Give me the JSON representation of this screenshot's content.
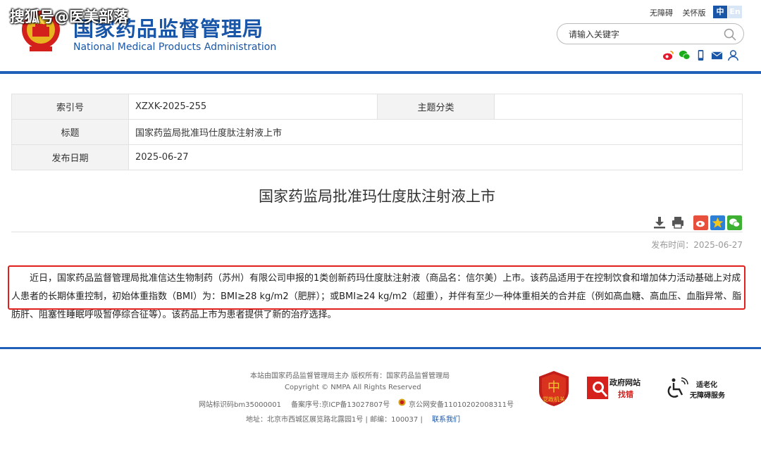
{
  "watermark": "搜狐号@医美部落",
  "site": {
    "name_cn": "国家药品监督管理局",
    "name_en": "National Medical Products Administration"
  },
  "top_links": {
    "accessibility": "无障碍",
    "elderly": "关怀版",
    "lang_zh": "中",
    "lang_en": "En"
  },
  "search": {
    "placeholder": "请输入关键字"
  },
  "info": {
    "index_label": "索引号",
    "index_value": "XZXK-2025-255",
    "topic_label": "主题分类",
    "topic_value": "",
    "title_label": "标题",
    "title_value": "国家药监局批准玛仕度肽注射液上市",
    "date_label": "发布日期",
    "date_value": "2025-06-27"
  },
  "article": {
    "title": "国家药监局批准玛仕度肽注射液上市",
    "publish_time": "发布时间：2025-06-27",
    "body": "近日，国家药品监督管理局批准信达生物制药（苏州）有限公司申报的1类创新药玛仕度肽注射液（商品名：信尔美）上市。该药品适用于在控制饮食和增加体力活动基础上对成人患者的长期体重控制，初始体重指数（BMI）为：BMI≥28 kg/m2（肥胖）；或BMI≥24 kg/m2（超重），并伴有至少一种体重相关的合并症（例如高血糖、高血压、血脂异常、脂肪肝、阻塞性睡眠呼吸暂停综合征等）。该药品上市为患者提供了新的治疗选择。"
  },
  "footer": {
    "line1": "本站由国家药品监督管理局主办 版权所有：国家药品监督管理局",
    "line2": "Copyright © NMPA All Rights Reserved",
    "site_id": "网站标识码bm35000001",
    "icp": "备案序号:京ICP备13027807号",
    "police": "京公网安备11010202008311号",
    "address": "地址：北京市西城区展览路北露园1号 | 邮编：100037 |",
    "contact": "联系我们",
    "badge_party": "党政机关",
    "badge_error_top": "政府网站",
    "badge_error_bottom": "找错",
    "badge_elder_top": "适老化",
    "badge_elder_bottom": "无障碍服务"
  },
  "colors": {
    "brand_blue": "#1a56a8",
    "highlight_red": "#e0201d"
  }
}
